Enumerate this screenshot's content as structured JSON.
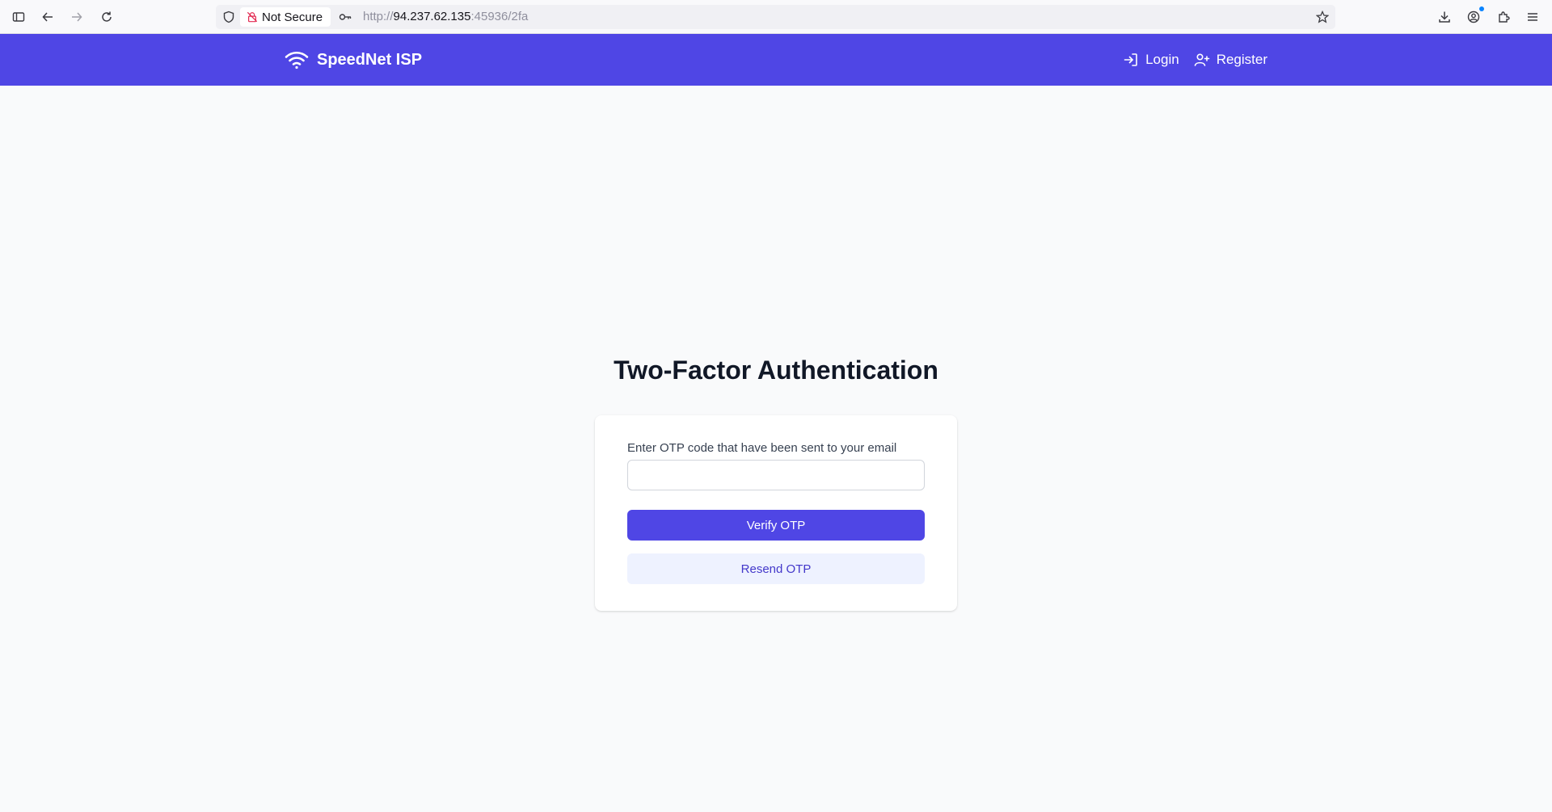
{
  "browser": {
    "security_label": "Not Secure",
    "url_scheme": "http://",
    "url_host": "94.237.62.135",
    "url_path": ":45936/2fa"
  },
  "navbar": {
    "brand": "SpeedNet ISP",
    "login_label": "Login",
    "register_label": "Register",
    "color": "#4f46e5"
  },
  "main": {
    "title": "Two-Factor Authentication",
    "otp_label": "Enter OTP code that have been sent to your email",
    "otp_value": "",
    "verify_label": "Verify OTP",
    "resend_label": "Resend OTP"
  }
}
